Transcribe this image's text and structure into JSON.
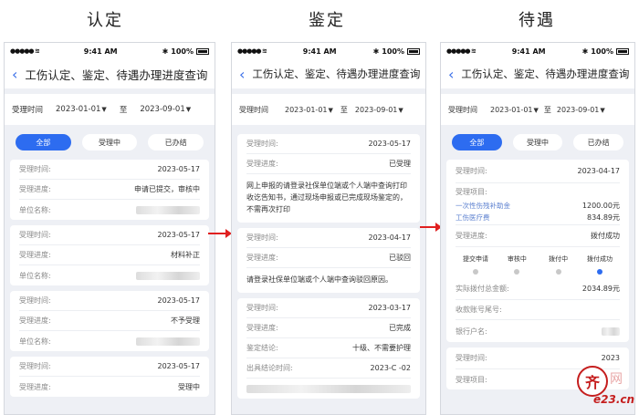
{
  "captions": [
    "认定",
    "鉴定",
    "待遇"
  ],
  "status": {
    "time": "9:41 AM",
    "battery": "100%"
  },
  "nav": {
    "title": "工伤认定、鉴定、待遇办理进度查询"
  },
  "filter": {
    "label": "受理时间",
    "start": "2023-01-01",
    "sep": "至",
    "end": "2023-09-01"
  },
  "tabs": [
    "全部",
    "受理中",
    "已办结"
  ],
  "screen1": {
    "cards": [
      {
        "rows": [
          {
            "label": "受理时间:",
            "value": "2023-05-17"
          },
          {
            "label": "受理进度:",
            "value": "申请已提交，审核中"
          },
          {
            "label": "单位名称:",
            "value": ""
          }
        ]
      },
      {
        "rows": [
          {
            "label": "受理时间:",
            "value": "2023-05-17"
          },
          {
            "label": "受理进度:",
            "value": "材料补正"
          },
          {
            "label": "单位名称:",
            "value": ""
          }
        ]
      },
      {
        "rows": [
          {
            "label": "受理时间:",
            "value": "2023-05-17"
          },
          {
            "label": "受理进度:",
            "value": "不予受理"
          },
          {
            "label": "单位名称:",
            "value": ""
          }
        ]
      },
      {
        "rows": [
          {
            "label": "受理时间:",
            "value": "2023-05-17"
          },
          {
            "label": "受理进度:",
            "value": "受理中"
          }
        ]
      }
    ]
  },
  "screen2": {
    "cards": [
      {
        "rows": [
          {
            "label": "受理时间:",
            "value": "2023-05-17"
          },
          {
            "label": "受理进度:",
            "value": "已受理"
          }
        ],
        "note": "网上申报的请登录社保单位端或个人端中查询打印收讫告知书，通过现场申报或已完成现场鉴定的，不需再次打印"
      },
      {
        "rows": [
          {
            "label": "受理时间:",
            "value": "2023-04-17"
          },
          {
            "label": "受理进度:",
            "value": "已驳回"
          }
        ],
        "note": "请登录社保单位端或个人端中查询驳回原因。"
      },
      {
        "rows": [
          {
            "label": "受理时间:",
            "value": "2023-03-17"
          },
          {
            "label": "受理进度:",
            "value": "已完成"
          },
          {
            "label": "鉴定结论:",
            "value": "十级、不需要护理"
          },
          {
            "label": "出具结论时间:",
            "value": "2023-C -02"
          }
        ]
      }
    ]
  },
  "screen3": {
    "time_label": "受理时间:",
    "time_value": "2023-04-17",
    "items_label": "受理项目:",
    "items": [
      {
        "label": "一次性伤残补助金",
        "value": "1200.00元"
      },
      {
        "label": "工伤医疗费",
        "value": "834.89元"
      }
    ],
    "progress_label": "受理进度:",
    "progress_value": "拨付成功",
    "steps": [
      "提交申请",
      "审核中",
      "拨付中",
      "拨付成功"
    ],
    "total_label": "实际拨付总金额:",
    "total_value": "2034.89元",
    "account_label": "收款账号尾号:",
    "bank_label": "银行户名:",
    "time2_label": "受理时间:",
    "time2_value": "2023",
    "items2_label": "受理项目:"
  },
  "logo": {
    "seal": "齐",
    "brand": "e23.cn",
    "wm": "网"
  }
}
